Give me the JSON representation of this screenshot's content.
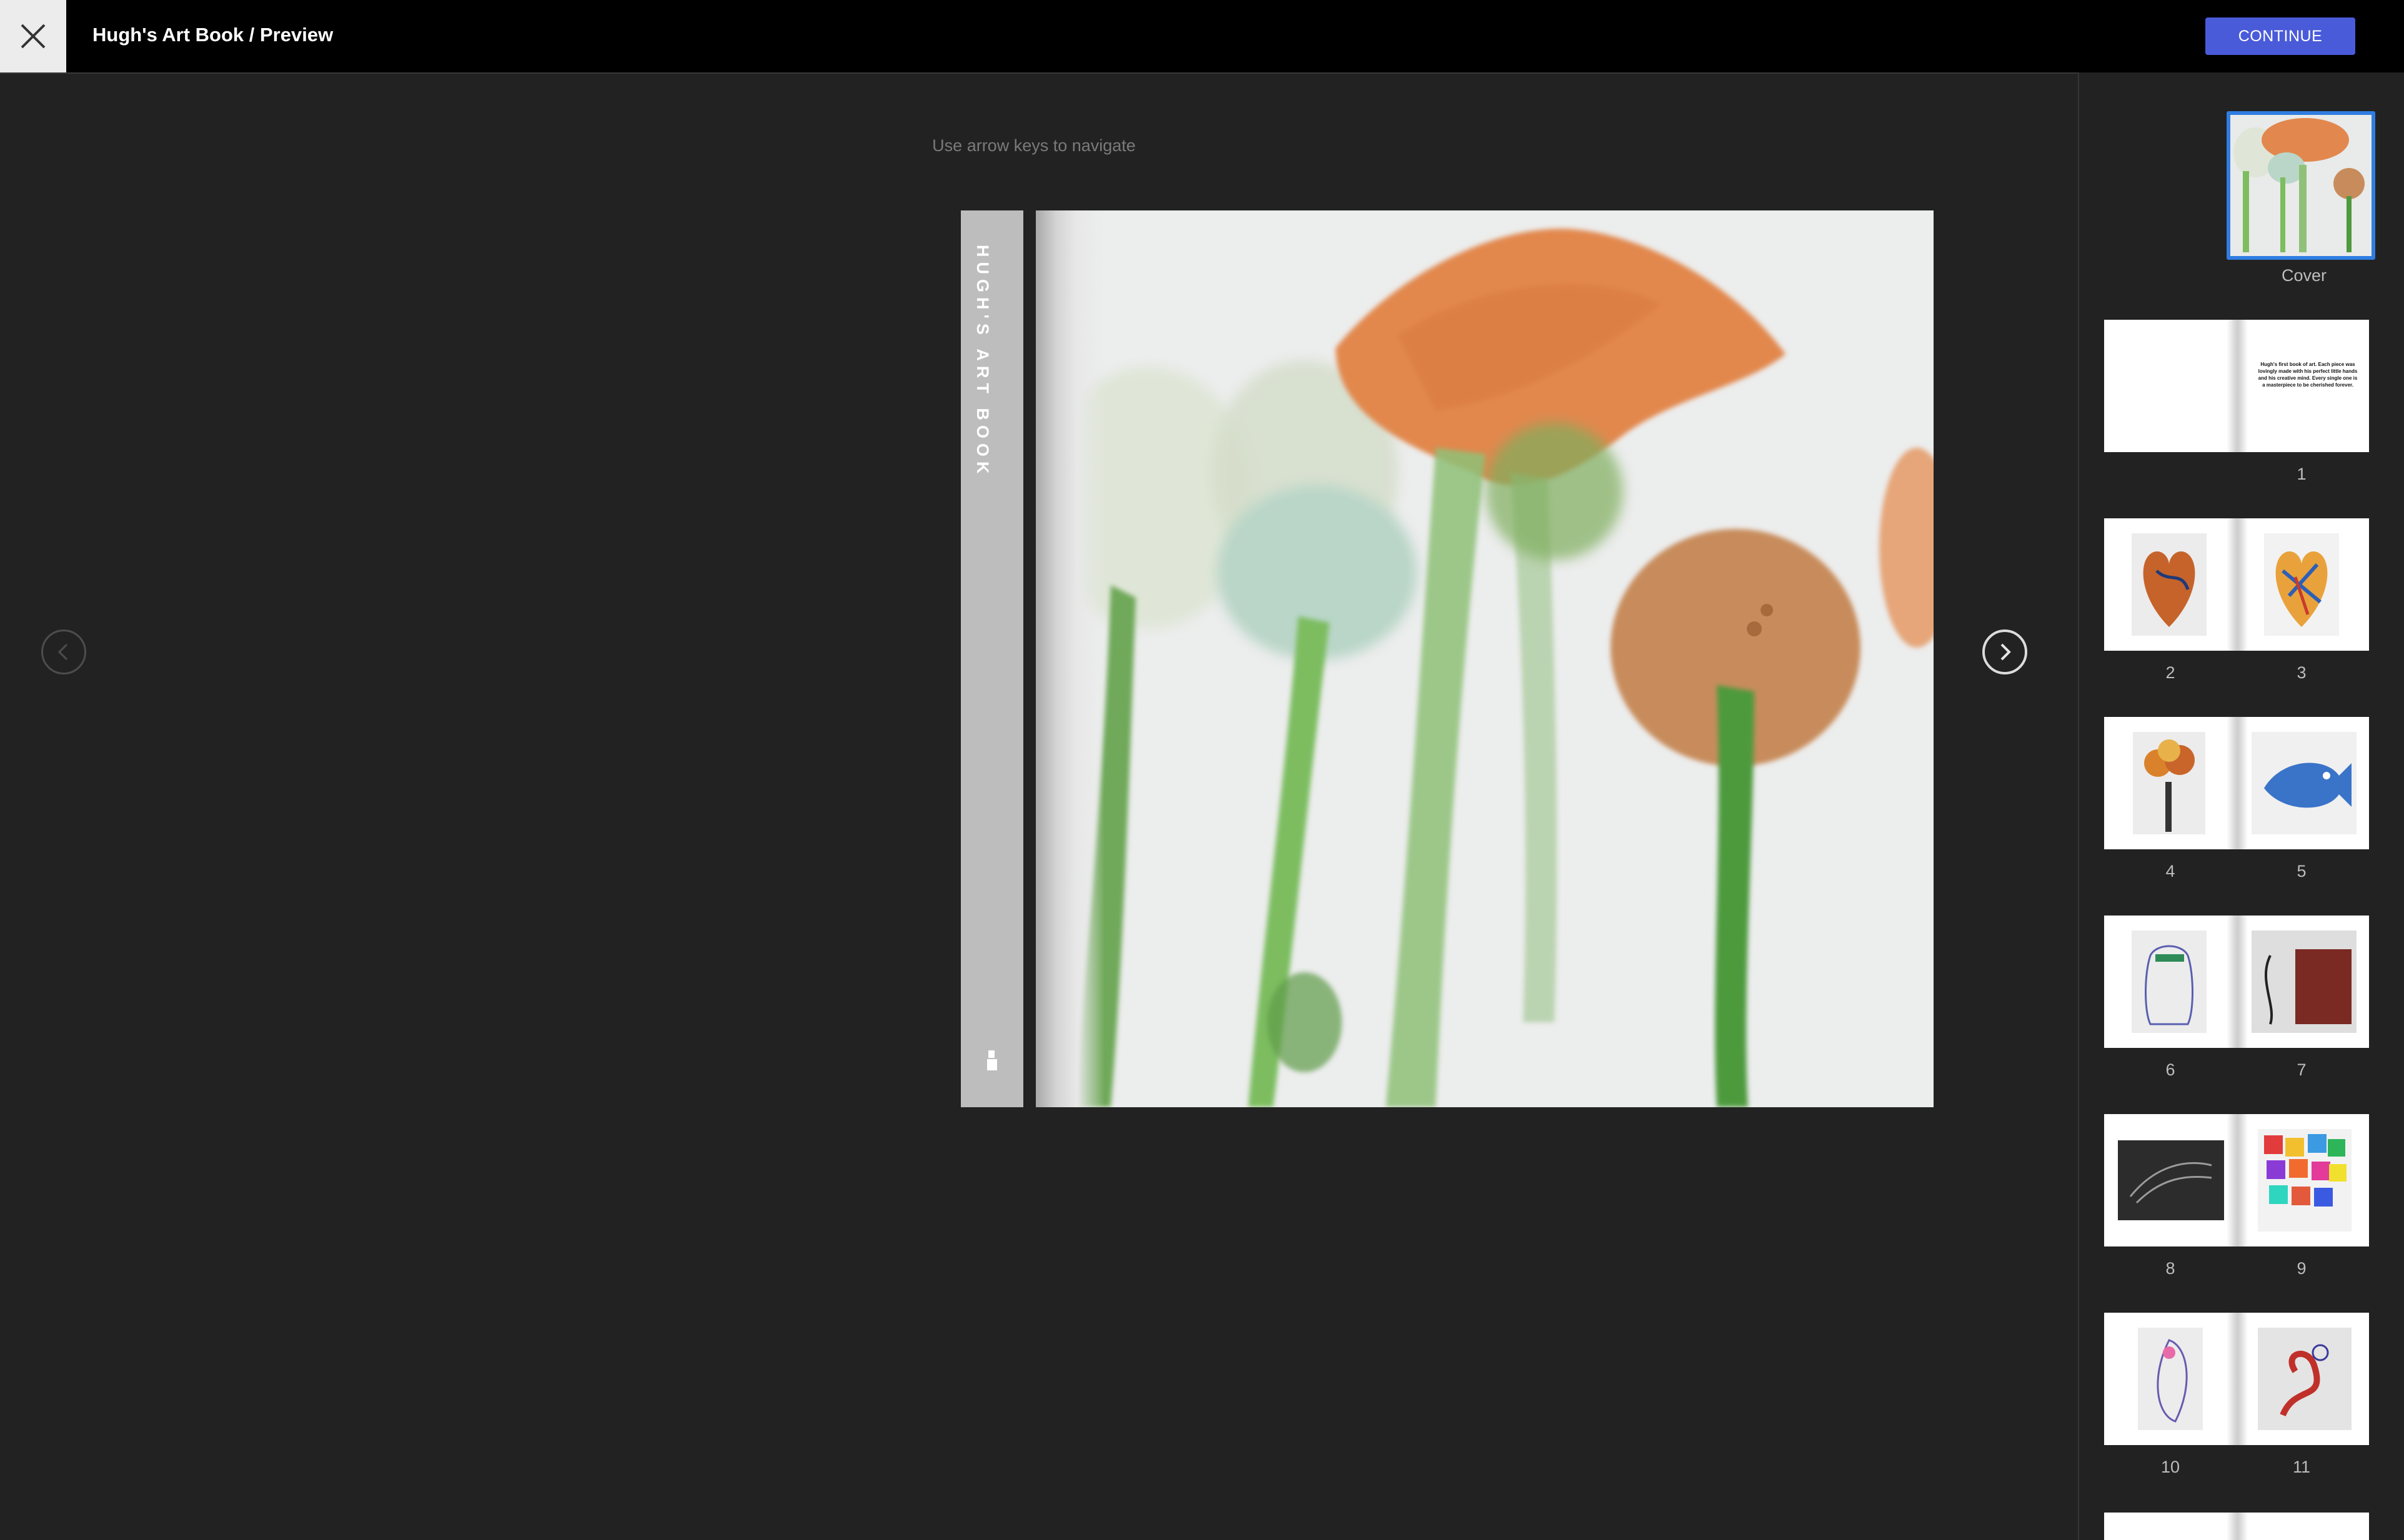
{
  "header": {
    "title": "Hugh's Art Book / Preview",
    "continue_label": "CONTINUE",
    "close_icon": "close-icon",
    "accent_color": "#4a5bd9"
  },
  "viewer": {
    "hint": "Use arrow keys to navigate",
    "spine_text": "HUGH'S ART BOOK",
    "prev_icon": "chevron-left-icon",
    "next_icon": "chevron-right-icon"
  },
  "sidebar": {
    "selected_color": "#2f7de1",
    "cover_label": "Cover",
    "page1_text": "Hugh's first book of art. Each piece was lovingly made with his perfect little hands and his creative mind. Every single one is a masterpiece to be cherished forever.",
    "spreads": [
      {
        "left": "",
        "right": "1"
      },
      {
        "left": "2",
        "right": "3"
      },
      {
        "left": "4",
        "right": "5"
      },
      {
        "left": "6",
        "right": "7"
      },
      {
        "left": "8",
        "right": "9"
      },
      {
        "left": "10",
        "right": "11"
      }
    ]
  }
}
